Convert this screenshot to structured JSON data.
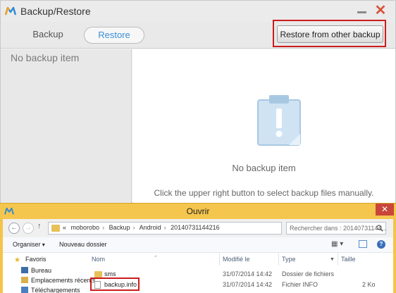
{
  "app": {
    "title": "Backup/Restore",
    "close_glyph": "✕",
    "tabs": [
      {
        "label": "Backup",
        "selected": false
      },
      {
        "label": "Restore",
        "selected": true
      }
    ],
    "restore_other_button": "Restore from other backup",
    "sidebar_empty_text": "No backup item",
    "main_empty_text": "No backup item",
    "main_hint": "Click the upper right button to select backup files manually.",
    "accent_color": "#3a8fd8",
    "highlight_color": "#cc1c1c"
  },
  "dialog": {
    "title": "Ouvrir",
    "close_glyph": "✕",
    "path": [
      "«",
      "moborobo",
      "Backup",
      "Android",
      "20140731144216"
    ],
    "search_placeholder": "Rechercher dans : 20140731144...",
    "toolbar": {
      "organize": "Organiser",
      "new_folder": "Nouveau dossier"
    },
    "nav": {
      "favorites": "Favoris",
      "items": [
        "Bureau",
        "Emplacements récents",
        "Téléchargements"
      ]
    },
    "columns": {
      "name": "Nom",
      "date": "Modifié le",
      "type": "Type",
      "size": "Taille"
    },
    "files": [
      {
        "name": "sms",
        "date": "31/07/2014 14:42",
        "type": "Dossier de fichiers",
        "size": "",
        "kind": "folder"
      },
      {
        "name": "backup.info",
        "date": "31/07/2014 14:42",
        "type": "Fichier INFO",
        "size": "2 Ko",
        "kind": "file"
      }
    ]
  }
}
